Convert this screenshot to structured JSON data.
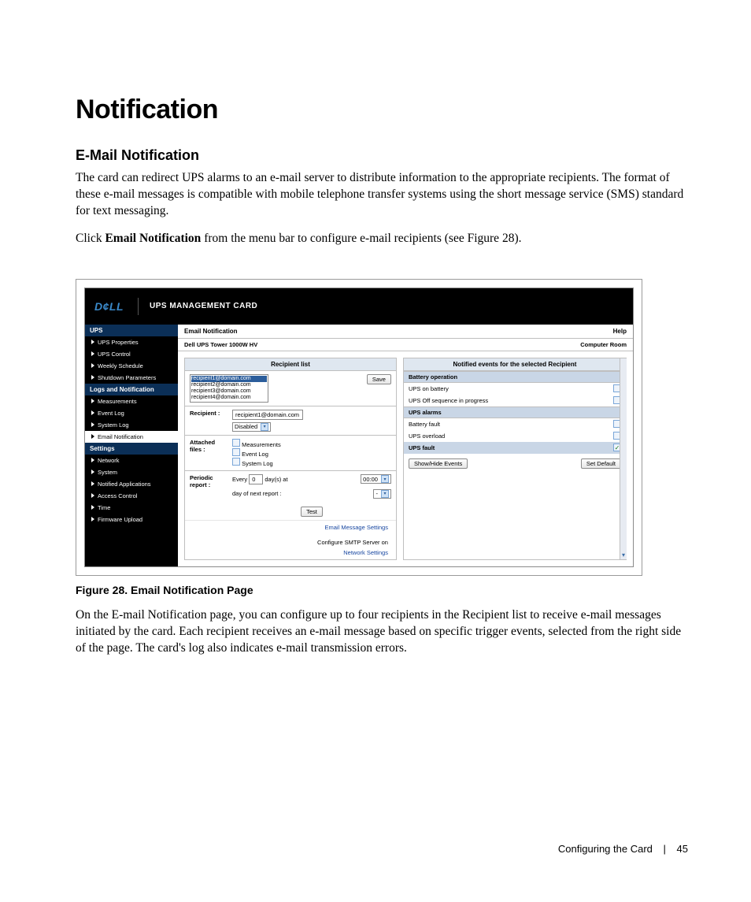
{
  "heading": "Notification",
  "subheading": "E-Mail Notification",
  "para1": "The card can redirect UPS alarms to an e-mail server to distribute information to the appropriate recipients. The format of these e-mail messages is compatible with mobile telephone transfer systems using the short message service (SMS) standard for text messaging.",
  "para2_pre": "Click ",
  "para2_bold": "Email Notification",
  "para2_post": " from the menu bar to configure e-mail recipients (see Figure 28).",
  "figure_caption": "Figure 28. Email Notification Page",
  "para3": "On the E-mail Notification page, you can configure up to four recipients in the Recipient list to receive e-mail messages initiated by the card. Each recipient receives an e-mail message based on specific trigger events, selected from the right side of the page. The card's log also indicates e-mail transmission errors.",
  "footer_section": "Configuring the Card",
  "footer_page": "45",
  "screenshot": {
    "brand": "D¢LL",
    "app_title": "UPS MANAGEMENT CARD",
    "main_title": "Email Notification",
    "help": "Help",
    "device": "Dell UPS Tower 1000W HV",
    "location": "Computer Room",
    "nav_head_ups": "UPS",
    "nav_ups": [
      "UPS Properties",
      "UPS Control",
      "Weekly Schedule",
      "Shutdown Parameters"
    ],
    "nav_head_logs": "Logs and Notification",
    "nav_logs": [
      "Measurements",
      "Event Log",
      "System Log",
      "Email Notification"
    ],
    "nav_head_settings": "Settings",
    "nav_settings": [
      "Network",
      "System",
      "Notified Applications",
      "Access Control",
      "Time",
      "Firmware Upload"
    ],
    "left_header": "Recipient list",
    "recipients": [
      "recipient1@domain.com",
      "recipient2@domain.com",
      "recipient3@domain.com",
      "recipient4@domain.com"
    ],
    "save": "Save",
    "recipient_label": "Recipient :",
    "recipient_value": "recipient1@domain.com",
    "status_value": "Disabled",
    "attached_label1": "Attached",
    "attached_label2": "files :",
    "attach_measurements": "Measurements",
    "attach_eventlog": "Event Log",
    "attach_systemlog": "System Log",
    "periodic_label1": "Periodic",
    "periodic_label2": "report :",
    "periodic_every": "Every",
    "periodic_days_value": "0",
    "periodic_days_unit": "day(s) at",
    "periodic_time": "00:00",
    "periodic_next": "day of next report :",
    "periodic_next_value": "-",
    "test": "Test",
    "link_email_settings": "Email Message Settings",
    "link_smtp1": "Configure SMTP Server on",
    "link_smtp2": "Network Settings",
    "right_header": "Notified events for the selected Recipient",
    "cat_battery": "Battery operation",
    "ev_on_battery": "UPS on battery",
    "ev_off_seq": "UPS Off sequence in progress",
    "cat_alarms": "UPS alarms",
    "ev_batt_fault": "Battery fault",
    "ev_overload": "UPS overload",
    "ev_fault": "UPS fault",
    "btn_showhide": "Show/Hide Events",
    "btn_setdefault": "Set Default"
  }
}
